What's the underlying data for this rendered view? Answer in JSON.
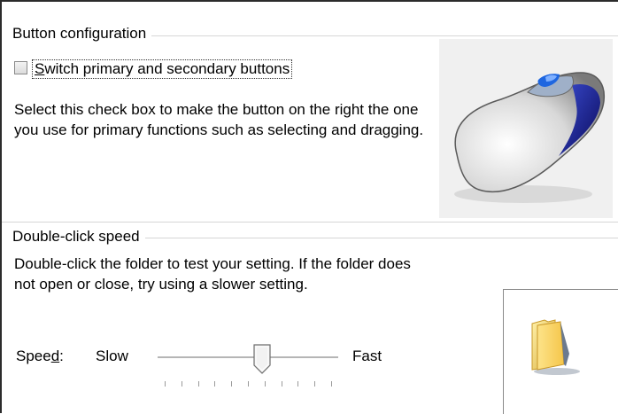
{
  "button_configuration": {
    "group_title": "Button configuration",
    "switch_checkbox": {
      "label_underline": "S",
      "label_rest": "witch primary and secondary buttons",
      "checked": false
    },
    "description": "Select this check box to make the button on the right the one you use for primary functions such as selecting and dragging.",
    "image_icon": "mouse-icon"
  },
  "double_click_speed": {
    "group_title": "Double-click speed",
    "description": "Double-click the folder to test your setting. If the folder does not open or close, try using a slower setting.",
    "speed_label_pre": "Spee",
    "speed_label_underline": "d",
    "speed_label_post": ":",
    "slow_label": "Slow",
    "fast_label": "Fast",
    "slider_level": 0.58,
    "tick_count": 11,
    "test_icon": "folder-icon"
  }
}
